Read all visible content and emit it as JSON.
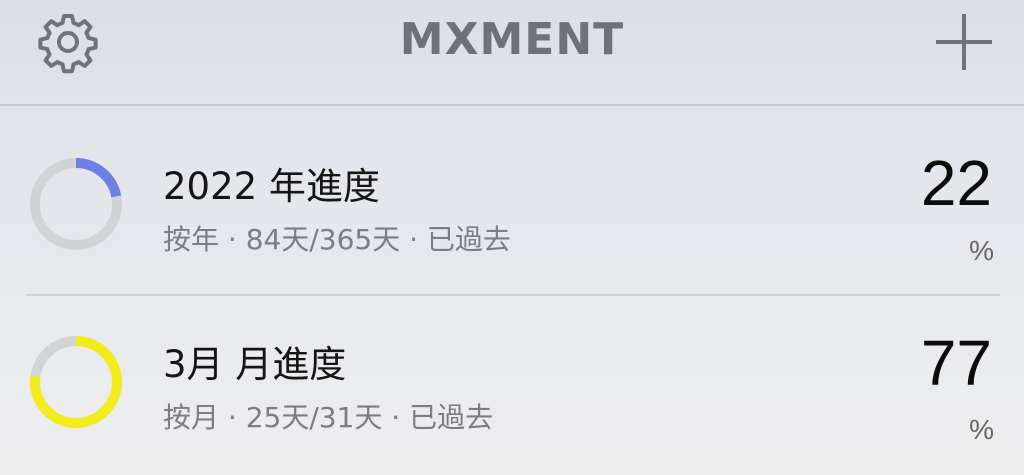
{
  "header": {
    "app_name": "MXMENT",
    "settings_icon": "gear-icon",
    "add_icon": "plus-icon"
  },
  "items": [
    {
      "title": "2022 年進度",
      "subtitle": "按年 · 84天/365天 · 已過去",
      "percent": "22",
      "percent_sign": "%",
      "progress": 0.22,
      "color": "#6f7fe6"
    },
    {
      "title": "3月 月進度",
      "subtitle": "按月 · 25天/31天 · 已過去",
      "percent": "77",
      "percent_sign": "%",
      "progress": 0.77,
      "color": "#f2ec1a"
    }
  ],
  "colors": {
    "ring_track": "#d2d3d6"
  }
}
